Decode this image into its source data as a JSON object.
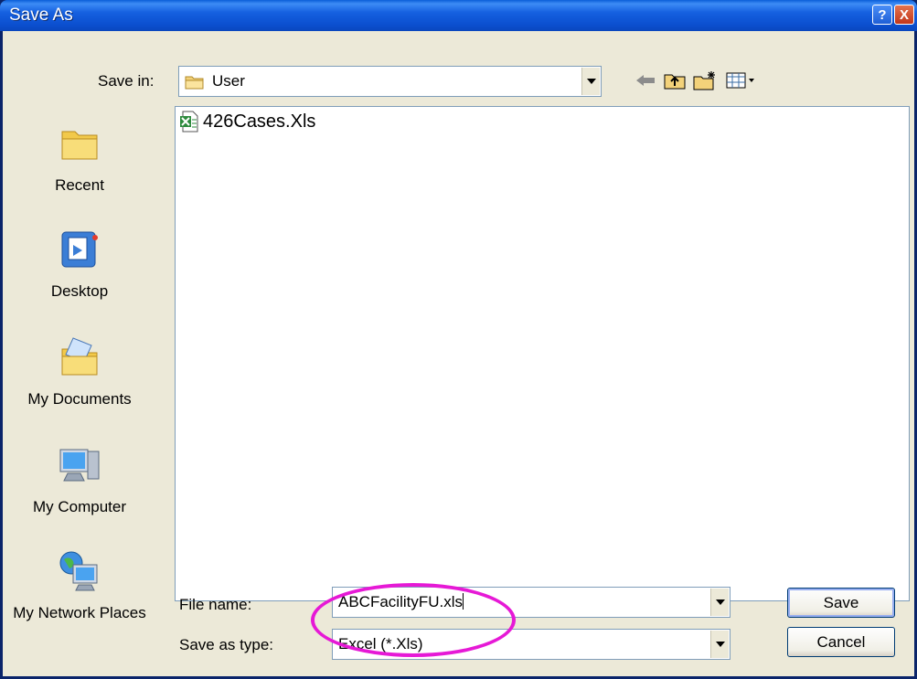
{
  "window": {
    "title": "Save As"
  },
  "title_buttons": {
    "help": "?",
    "close": "X"
  },
  "toolbar": {
    "save_in_label": "Save in:",
    "save_in_value": "User"
  },
  "places": [
    {
      "label": "Recent",
      "icon": "recent-folder-icon"
    },
    {
      "label": "Desktop",
      "icon": "desktop-icon"
    },
    {
      "label": "My Documents",
      "icon": "my-documents-icon"
    },
    {
      "label": "My Computer",
      "icon": "my-computer-icon"
    },
    {
      "label": "My Network Places",
      "icon": "network-places-icon"
    }
  ],
  "files": [
    {
      "name": "426Cases.Xls",
      "icon": "excel-file-icon"
    }
  ],
  "form": {
    "filename_label": "File name:",
    "filename_value": "ABCFacilityFU.xls",
    "savetype_label": "Save as type:",
    "savetype_value": "Excel (*.Xls)"
  },
  "buttons": {
    "save": "Save",
    "cancel": "Cancel"
  },
  "colors": {
    "highlight": "#e619d6",
    "titlebar": "#0b4fcf"
  }
}
